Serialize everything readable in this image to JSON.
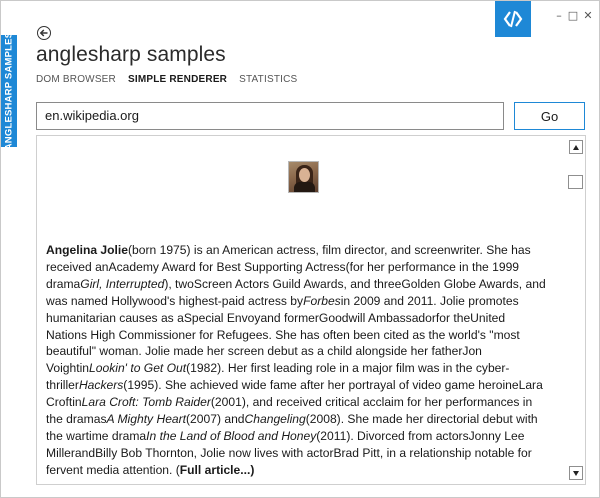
{
  "app": {
    "side_label": "ANGLESHARP SAMPLES",
    "title": "anglesharp samples",
    "accent_color": "#1e88d6",
    "logo_icon": "anglesharp-logo-icon"
  },
  "window_controls": {
    "minimize": "–",
    "maximize": "□",
    "close": "✕"
  },
  "tabs": [
    {
      "label": "DOM BROWSER",
      "active": false
    },
    {
      "label": "SIMPLE RENDERER",
      "active": true
    },
    {
      "label": "STATISTICS",
      "active": false
    }
  ],
  "address_bar": {
    "value": "en.wikipedia.org",
    "go_label": "Go"
  },
  "article": {
    "image_alt": "Angelina Jolie thumbnail",
    "lines": [
      [
        {
          "t": "Angelina Jolie",
          "s": "b"
        },
        {
          "t": "(born 1975) is an American actress, film director, and screenwriter. She has"
        }
      ],
      [
        {
          "t": "received anAcademy Award for Best Supporting Actress(for her performance in the 1999"
        }
      ],
      [
        {
          "t": "drama"
        },
        {
          "t": "Girl, Interrupted",
          "s": "i"
        },
        {
          "t": "), twoScreen Actors Guild Awards, and threeGolden Globe Awards, and"
        }
      ],
      [
        {
          "t": "was named Hollywood's highest-paid actress by"
        },
        {
          "t": "Forbes",
          "s": "i"
        },
        {
          "t": "in 2009 and 2011. Jolie promotes"
        }
      ],
      [
        {
          "t": "humanitarian causes as aSpecial Envoyand formerGoodwill Ambassadorfor theUnited"
        }
      ],
      [
        {
          "t": "Nations High Commissioner for Refugees. She has often been cited as the world's \"most"
        }
      ],
      [
        {
          "t": "beautiful\" woman. Jolie made her screen debut as a child alongside her fatherJon"
        }
      ],
      [
        {
          "t": "Voightin"
        },
        {
          "t": "Lookin' to Get Out",
          "s": "i"
        },
        {
          "t": "(1982). Her first leading role in a major film was in the cyber-"
        }
      ],
      [
        {
          "t": "thriller"
        },
        {
          "t": "Hackers",
          "s": "i"
        },
        {
          "t": "(1995). She achieved wide fame after her portrayal of video game heroineLara"
        }
      ],
      [
        {
          "t": "Croftin"
        },
        {
          "t": "Lara Croft: Tomb Raider",
          "s": "i"
        },
        {
          "t": "(2001), and received critical acclaim for her performances in"
        }
      ],
      [
        {
          "t": "the dramas"
        },
        {
          "t": "A Mighty Heart",
          "s": "i"
        },
        {
          "t": "(2007) and"
        },
        {
          "t": "Changeling",
          "s": "i"
        },
        {
          "t": "(2008). She made her directorial debut with"
        }
      ],
      [
        {
          "t": "the wartime drama"
        },
        {
          "t": "In the Land of Blood and Honey",
          "s": "i"
        },
        {
          "t": "(2011). Divorced from actorsJonny Lee"
        }
      ],
      [
        {
          "t": "MillerandBilly Bob Thornton, Jolie now lives with actorBrad Pitt, in a relationship notable for"
        }
      ],
      [
        {
          "t": "fervent media attention. ("
        },
        {
          "t": "Full article...",
          "s": "b"
        },
        {
          "t": ")",
          "s": "b"
        }
      ]
    ]
  }
}
